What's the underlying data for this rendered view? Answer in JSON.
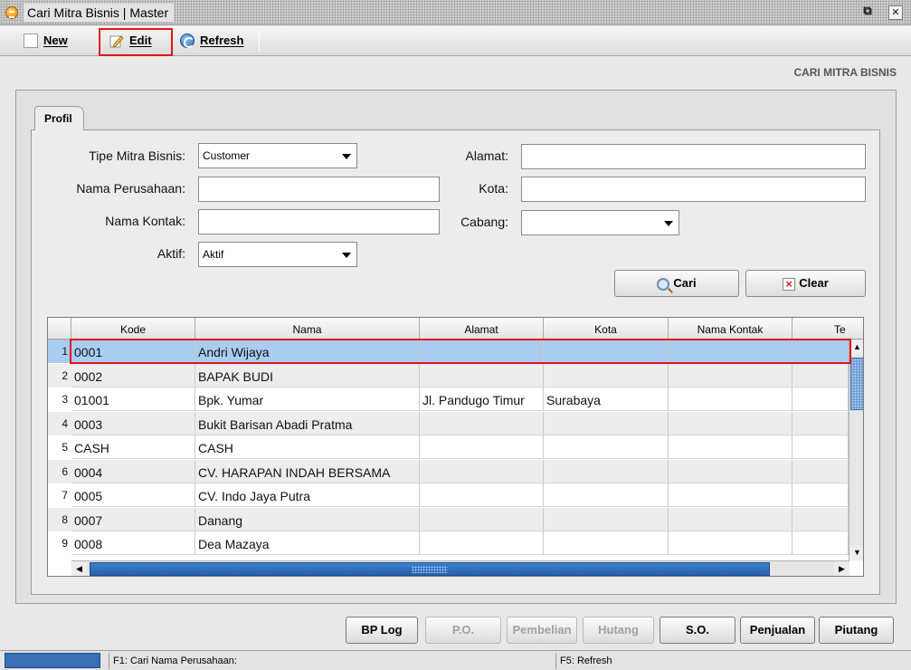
{
  "window": {
    "title": "Cari Mitra Bisnis | Master",
    "restore_glyph": "⧉",
    "close_glyph": "✕"
  },
  "toolbar": {
    "new_label": "New",
    "edit_label": "Edit",
    "refresh_label": "Refresh"
  },
  "page_heading": "CARI MITRA BISNIS",
  "tab": {
    "label": "Profil"
  },
  "form": {
    "tipe_label": "Tipe Mitra Bisnis:",
    "tipe_value": "Customer",
    "nama_perusahaan_label": "Nama Perusahaan:",
    "nama_perusahaan_value": "",
    "nama_kontak_label": "Nama Kontak:",
    "nama_kontak_value": "",
    "aktif_label": "Aktif:",
    "aktif_value": "Aktif",
    "alamat_label": "Alamat:",
    "alamat_value": "",
    "kota_label": "Kota:",
    "kota_value": "",
    "cabang_label": "Cabang:",
    "cabang_value": "",
    "cari_label": "Cari",
    "clear_label": "Clear",
    "clear_glyph": "×"
  },
  "grid": {
    "columns": [
      "Kode",
      "Nama",
      "Alamat",
      "Kota",
      "Nama Kontak",
      "Te"
    ],
    "rows": [
      {
        "num": "1",
        "kode": "0001",
        "nama": "Andri Wijaya",
        "alamat": "",
        "kota": "",
        "kontak": "",
        "te": ""
      },
      {
        "num": "2",
        "kode": "0002",
        "nama": "BAPAK BUDI",
        "alamat": "",
        "kota": "",
        "kontak": "",
        "te": ""
      },
      {
        "num": "3",
        "kode": "01001",
        "nama": "Bpk. Yumar",
        "alamat": "Jl. Pandugo Timur",
        "kota": "Surabaya",
        "kontak": "",
        "te": ""
      },
      {
        "num": "4",
        "kode": "0003",
        "nama": "Bukit Barisan Abadi Pratma",
        "alamat": "",
        "kota": "",
        "kontak": "",
        "te": ""
      },
      {
        "num": "5",
        "kode": "CASH",
        "nama": "CASH",
        "alamat": "",
        "kota": "",
        "kontak": "",
        "te": ""
      },
      {
        "num": "6",
        "kode": "0004",
        "nama": "CV. HARAPAN INDAH BERSAMA",
        "alamat": "",
        "kota": "",
        "kontak": "",
        "te": ""
      },
      {
        "num": "7",
        "kode": "0005",
        "nama": "CV. Indo Jaya Putra",
        "alamat": "",
        "kota": "",
        "kontak": "",
        "te": ""
      },
      {
        "num": "8",
        "kode": "0007",
        "nama": "Danang",
        "alamat": "",
        "kota": "",
        "kontak": "",
        "te": ""
      },
      {
        "num": "9",
        "kode": "0008",
        "nama": "Dea Mazaya",
        "alamat": "",
        "kota": "",
        "kontak": "",
        "te": ""
      }
    ],
    "selected_row": "1"
  },
  "bottom_buttons": {
    "bp_log": "BP Log",
    "po": "P.O.",
    "pembelian": "Pembelian",
    "hutang": "Hutang",
    "so": "S.O.",
    "penjualan": "Penjualan",
    "piutang": "Piutang"
  },
  "status": {
    "f1": "F1: Cari Nama Perusahaan:",
    "f5": "F5: Refresh"
  },
  "colors": {
    "selected_row": "#a9cdf1",
    "highlight": "#e0141b",
    "scroll_thumb": "#2f6cba"
  }
}
